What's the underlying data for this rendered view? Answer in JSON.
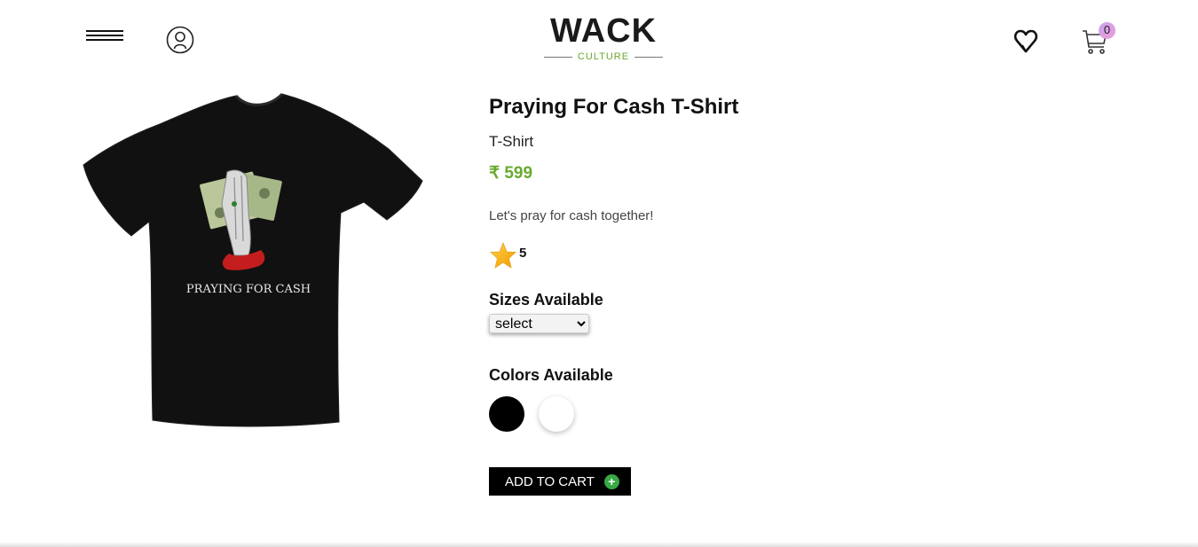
{
  "header": {
    "logo_main": "WACK",
    "logo_sub": "CULTURE",
    "cart_count": "0",
    "icons": [
      "menu-icon",
      "user-icon",
      "heart-icon",
      "cart-icon"
    ]
  },
  "product": {
    "title": "Praying For Cash T-Shirt",
    "category": "T-Shirt",
    "price": "₹ 599",
    "description": "Let's pray for cash together!",
    "rating": "5",
    "graphic_text": "PRAYING FOR CASH",
    "sizes_label": "Sizes Available",
    "size_selected": "select",
    "colors_label": "Colors Available",
    "colors": [
      "#000000",
      "#ffffff"
    ],
    "add_to_cart_label": "ADD TO CART"
  },
  "theme": {
    "accent": "#6aa92f",
    "button_bg": "#000000",
    "plus_green": "#37a845"
  }
}
